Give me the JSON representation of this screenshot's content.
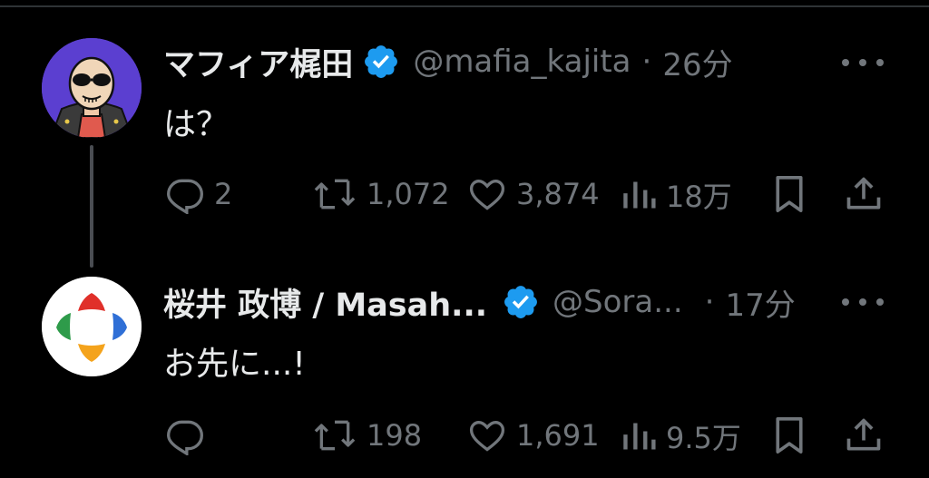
{
  "colors": {
    "background": "#000000",
    "text": "#e7e9ea",
    "muted": "#71767b",
    "verified": "#1d9bf0"
  },
  "tweets": [
    {
      "name": "マフィア梶田",
      "handle": "@mafia_kajita",
      "dot": "·",
      "time": "26分",
      "text": "は？",
      "replies": "2",
      "retweets": "1,072",
      "likes": "3,874",
      "views": "18万"
    },
    {
      "name": "桜井 政博 / Masah...",
      "handle": "@Sora...",
      "dot": "·",
      "time": "17分",
      "text": "お先に...!",
      "replies": "",
      "retweets": "198",
      "likes": "1,691",
      "views": "9.5万"
    }
  ],
  "icons": [
    "reply-icon",
    "retweet-icon",
    "like-icon",
    "views-icon",
    "bookmark-icon",
    "share-icon",
    "more-icon",
    "verified-icon"
  ]
}
